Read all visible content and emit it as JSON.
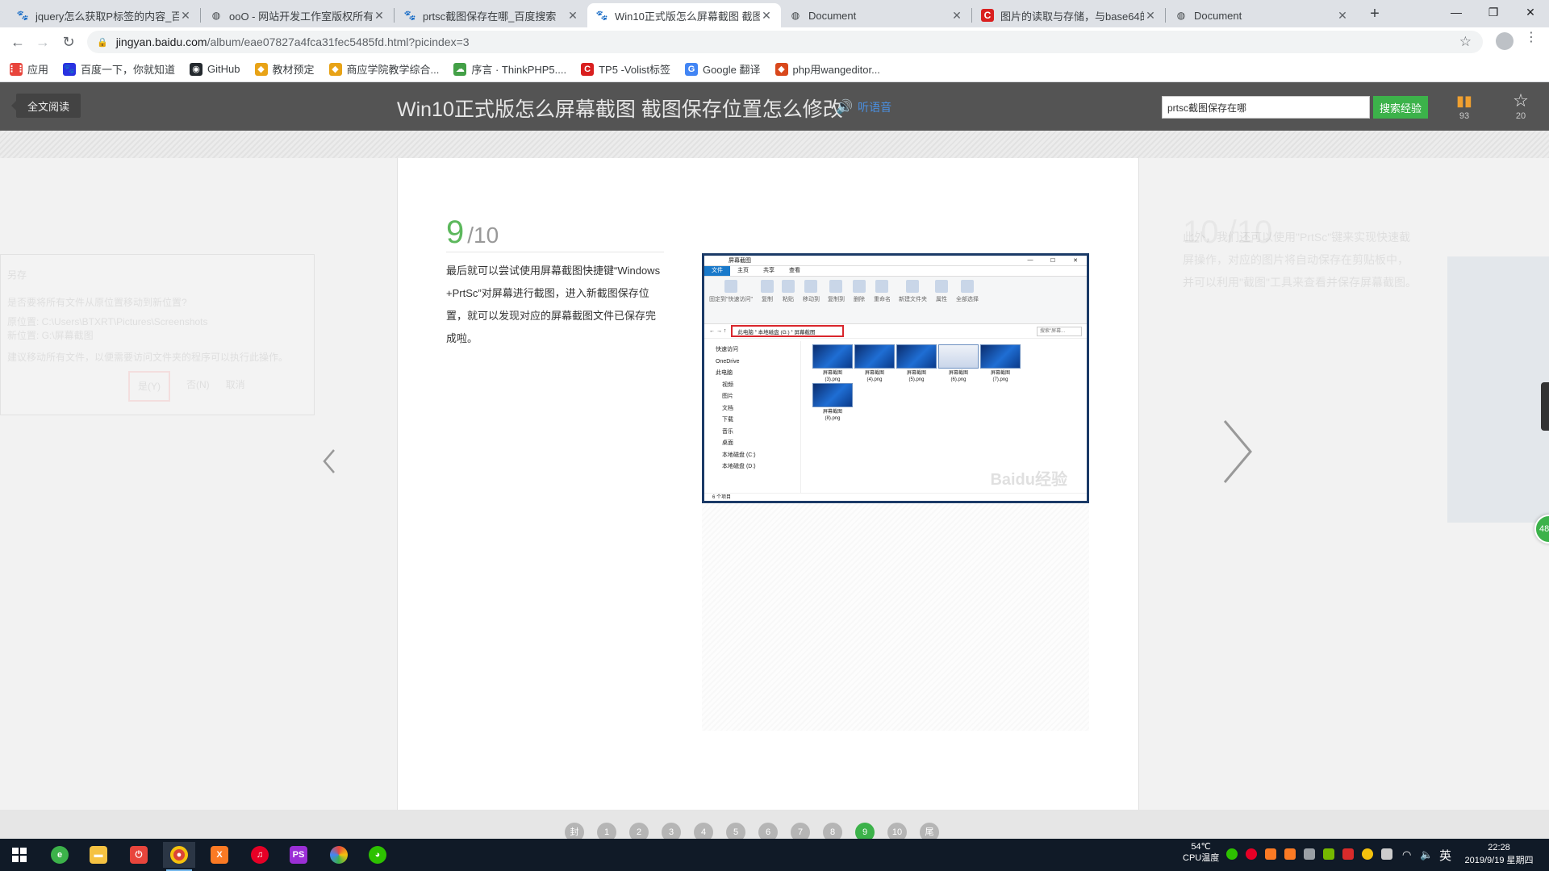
{
  "tabs": [
    {
      "title": "jquery怎么获取P标签的内容_百度",
      "icon": "baidu-paw-icon"
    },
    {
      "title": "ooO - 网站开发工作室版权所有",
      "icon": "globe-icon"
    },
    {
      "title": "prtsc截图保存在哪_百度搜索",
      "icon": "baidu-paw-icon"
    },
    {
      "title": "Win10正式版怎么屏幕截图 截图",
      "icon": "baidu-paw-icon"
    },
    {
      "title": "Document",
      "icon": "globe-icon"
    },
    {
      "title": "图片的读取与存储，与base64的",
      "icon": "csdn-icon"
    },
    {
      "title": "Document",
      "icon": "globe-icon"
    }
  ],
  "address": {
    "host": "jingyan.baidu.com",
    "path": "/album/eae07827a4fca31fec5485fd.html?picindex=3"
  },
  "bookmarks": [
    {
      "label": "应用",
      "icon": "apps-grid-icon",
      "color": "#e8453c"
    },
    {
      "label": "百度一下，你就知道",
      "icon": "baidu-paw-icon",
      "color": "#2932e1"
    },
    {
      "label": "GitHub",
      "icon": "github-icon",
      "color": "#24292e"
    },
    {
      "label": "教材预定",
      "icon": "bookmark-icon",
      "color": "#e8a317"
    },
    {
      "label": "商应学院教学综合...",
      "icon": "bookmark-icon",
      "color": "#e8a317"
    },
    {
      "label": "序言 · ThinkPHP5....",
      "icon": "thinkphp-icon",
      "color": "#43a047"
    },
    {
      "label": "TP5 -Volist标签",
      "icon": "csdn-icon",
      "color": "#d91f1f"
    },
    {
      "label": "Google 翻译",
      "icon": "translate-icon",
      "color": "#4285f4"
    },
    {
      "label": "php用wangeditor...",
      "icon": "bookmark-icon",
      "color": "#d9481c"
    }
  ],
  "header": {
    "read_all": "全文阅读",
    "title": "Win10正式版怎么屏幕截图 截图保存位置怎么修改",
    "listen": "听语音",
    "search_value": "prtsc截图保存在哪",
    "search_button": "搜索经验",
    "stats": [
      {
        "icon": "bar-chart-icon",
        "value": "93"
      },
      {
        "icon": "star-icon",
        "value": "20"
      }
    ]
  },
  "step": {
    "current": "9",
    "total": "/10",
    "text": "最后就可以尝试使用屏幕截图快捷键“Windows+PrtSc”对屏幕进行截图，进入新截图保存位置，就可以发现对应的屏幕截图文件已保存完成啦。"
  },
  "explorer": {
    "window_title": "屏幕截图",
    "ribbon_tabs": [
      "文件",
      "主页",
      "共享",
      "查看"
    ],
    "ribbon_groups": [
      "固定到\"快速访问\"",
      "复制",
      "粘贴",
      "移动到",
      "复制到",
      "删除",
      "重命名",
      "新建文件夹",
      "属性",
      "全部选择"
    ],
    "path": [
      "此电脑",
      "本地磁盘 (G:)",
      "屏幕截图"
    ],
    "search_placeholder": "搜索\"屏幕...",
    "nav": [
      "快速访问",
      "OneDrive",
      "此电脑",
      "视频",
      "图片",
      "文档",
      "下载",
      "音乐",
      "桌面",
      "本地磁盘 (C:)",
      "本地磁盘 (D:)"
    ],
    "files": [
      "屏幕截图\n(3).png",
      "屏幕截图\n(4).png",
      "屏幕截图\n(5).png",
      "屏幕截图\n(6).png",
      "屏幕截图\n(7).png",
      "屏幕截图\n(8).png"
    ],
    "status": "6 个项目",
    "watermark": "Baidu经验"
  },
  "ghost_left": [
    "另存",
    "是否要将所有文件从原位置移动到新位置?",
    "原位置: C:\\Users\\BTXRT\\Pictures\\Screenshots",
    "新位置: G:\\屏幕截图",
    "建议移动所有文件，以便需要访问文件夹的程序可以执行此操作。",
    "是(Y)",
    "否(N)",
    "取消"
  ],
  "ghost_right": {
    "num": "10 /10",
    "text": "此外，我们还可以使用\"PrtSc\"键来实现快速截屏操作，对应的图片将自动保存在剪贴板中，并可以利用\"截图\"工具来查看并保存屏幕截图。"
  },
  "pager": [
    "封",
    "1",
    "2",
    "3",
    "4",
    "5",
    "6",
    "7",
    "8",
    "9",
    "10",
    "尾"
  ],
  "pager_active": "9",
  "side_badge": "48",
  "tray": {
    "temp": "54℃",
    "temp_label": "CPU温度",
    "ime": "英",
    "time": "22:28",
    "date": "2019/9/19 星期四"
  }
}
